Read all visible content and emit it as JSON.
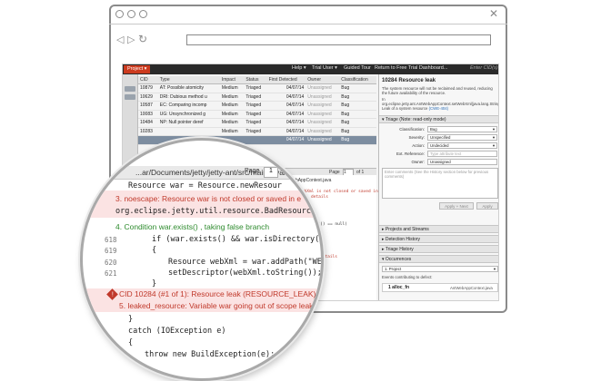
{
  "app": {
    "project_label": "Project",
    "menu": [
      "Help ▾",
      "Trial User ▾",
      "Guided Tour",
      "Return to Free Trial Dashboard...",
      "Enter CID(s)"
    ]
  },
  "grid": {
    "columns": [
      "CID",
      "Type",
      "Impact",
      "Status",
      "First Detected",
      "Owner",
      "Classification"
    ],
    "rows": [
      [
        "10879",
        "AT: Possible atomicity",
        "Medium",
        "Triaged",
        "04/07/14",
        "Unassigned",
        "Bug"
      ],
      [
        "10629",
        "DRI: Dubious method u",
        "Medium",
        "Triaged",
        "04/07/14",
        "Unassigned",
        "Bug"
      ],
      [
        "10587",
        "EC: Comparing incomp",
        "Medium",
        "Triaged",
        "04/07/14",
        "Unassigned",
        "Bug"
      ],
      [
        "10083",
        "UG: Unsynchronized g",
        "Medium",
        "Triaged",
        "04/07/14",
        "Unassigned",
        "Bug"
      ],
      [
        "10484",
        "NP: Null pointer deref",
        "Medium",
        "Triaged",
        "04/07/14",
        "Unassigned",
        "Bug"
      ],
      [
        "10283",
        "",
        "Medium",
        "Triaged",
        "04/07/14",
        "Unassigned",
        "Bug"
      ],
      [
        "",
        "",
        "",
        "",
        "04/07/14",
        "Unassigned",
        "Bug"
      ]
    ]
  },
  "pager": {
    "label": "Page",
    "value": "1",
    "of": "of 1"
  },
  "details": {
    "title": "10284 Resource leak",
    "desc1": "The system resource will not be reclaimed and reused, reducing the future availability of the resource.",
    "desc2": "In org.eclipse.jetty.ant.AntWebAppContext.setWebXml(java.lang.String): Leak of a system resource",
    "cwe": "(CWE-404)",
    "triage_header": "Triage (Note: read-only mode)",
    "fields": [
      {
        "label": "Classification:",
        "value": "Bug"
      },
      {
        "label": "Severity:",
        "value": "Unspecified"
      },
      {
        "label": "Action:",
        "value": "Undecided"
      },
      {
        "label": "Ext. Reference:",
        "value": "Type attribute text"
      },
      {
        "label": "Owner:",
        "value": "Unassigned"
      }
    ],
    "comment_placeholder": "Enter comments (See the History section below for previous comments)",
    "apply_next": "Apply + Next",
    "apply": "Apply",
    "sections": [
      "Projects and Streams",
      "Detection History",
      "Triage History",
      "Occurrences"
    ],
    "occ_select": "1. Project",
    "events_label": "Events contributing to defect:",
    "event1": "1  alloc_fn",
    "event1_file": "AntWebAppContext.java"
  },
  "editor": {
    "path": "...ar/Documents/jetty/jetty-ant/src/main/java",
    "file": "AntWebAppContext.java",
    "lines": [
      "resource: webXml is not closed or saved in ",
      "details",
      "tor() == null)",
      "details"
    ]
  },
  "mag": {
    "path": "...ar/Documents/jetty/jetty-ant/src/main/java/",
    "pager_label": "Page",
    "pager_value": "1",
    "lines": [
      {
        "num": "",
        "text": "Resource war = Resource.newResour",
        "color": "#222"
      },
      {
        "num": "",
        "text": "3. noescape: Resource war is not closed or saved in e",
        "color": "#c0392b"
      },
      {
        "num": "",
        "text": "org.eclipse.jetty.util.resource.BadResource.e",
        "color": "#222"
      },
      {
        "num": "",
        "text": "4. Condition war.exists() , taking false branch",
        "color": "#2e8b2e"
      },
      {
        "num": "618",
        "text": "if (war.exists() && war.isDirectory()",
        "color": "#222"
      },
      {
        "num": "619",
        "text": "{",
        "color": "#222"
      },
      {
        "num": "620",
        "text": "Resource webXml = war.addPath(\"WEB",
        "color": "#222"
      },
      {
        "num": "621",
        "text": "setDescriptor(webXml.toString());",
        "color": "#222"
      },
      {
        "num": "",
        "text": "}",
        "color": "#222"
      },
      {
        "num": "",
        "text": "CID 10284 (#1 of 1): Resource leak (RESOURCE_LEAK)",
        "color": "#c0392b"
      },
      {
        "num": "",
        "text": "5. leaked_resource: Variable war going out of scope leak",
        "color": "#c0392b"
      },
      {
        "num": "",
        "text": "}",
        "color": "#222"
      },
      {
        "num": "",
        "text": "catch (IOException e)",
        "color": "#222"
      },
      {
        "num": "",
        "text": "{",
        "color": "#222"
      },
      {
        "num": "",
        "text": "throw new BuildException(e);",
        "color": "#222"
      },
      {
        "num": "",
        "text": "}",
        "color": "#222"
      }
    ]
  },
  "colors": {
    "project_red": "#cc3b1f",
    "selected_row": "#7d8da0",
    "error_red": "#c0392b",
    "event_green": "#2e8b2e"
  },
  "icons": [
    "back-icon",
    "forward-icon",
    "reload-icon",
    "close-icon",
    "warning-icon"
  ]
}
